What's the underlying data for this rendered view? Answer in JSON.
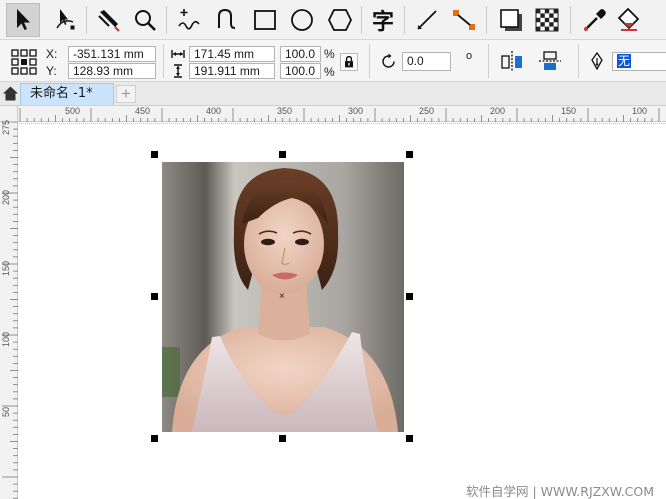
{
  "toolbox": {
    "tools": [
      {
        "name": "pick-tool",
        "icon": "arrow-pointer-icon",
        "active": true
      },
      {
        "name": "shape-tool",
        "icon": "node-shape-icon"
      },
      {
        "name": "smart-fill-tool",
        "icon": "knife-brush-icon"
      },
      {
        "name": "zoom-tool",
        "icon": "magnifier-icon"
      },
      {
        "name": "freehand-tool",
        "icon": "freehand-curve-icon"
      },
      {
        "name": "artistic-media-tool",
        "icon": "spiral-brush-icon"
      },
      {
        "name": "rectangle-tool",
        "icon": "rectangle-icon"
      },
      {
        "name": "ellipse-tool",
        "icon": "ellipse-icon"
      },
      {
        "name": "polygon-tool",
        "icon": "hexagon-icon"
      },
      {
        "name": "text-tool",
        "icon": "text-zi-icon",
        "glyph": "字"
      },
      {
        "name": "parallel-dimension-tool",
        "icon": "dimension-line-icon"
      },
      {
        "name": "connector-tool",
        "icon": "connector-icon"
      },
      {
        "name": "drop-shadow-tool",
        "icon": "drop-shadow-icon"
      },
      {
        "name": "transparency-tool",
        "icon": "checkerboard-icon"
      },
      {
        "name": "color-eyedropper-tool",
        "icon": "eyedropper-icon"
      },
      {
        "name": "interactive-fill-tool",
        "icon": "paint-bucket-icon"
      }
    ]
  },
  "propbar": {
    "x_label": "X:",
    "y_label": "Y:",
    "x_value": "-351.131 mm",
    "y_value": "128.93 mm",
    "width_value": "171.45 mm",
    "height_value": "191.911 mm",
    "scale_x": "100.0",
    "scale_y": "100.0",
    "percent": "%",
    "rotation": "0.0",
    "degree": "o",
    "outline_width": "无"
  },
  "tabs": {
    "document_title": "未命名 -1*",
    "add_label": "+"
  },
  "ruler": {
    "h_labels": [
      "500",
      "450",
      "400",
      "350",
      "300",
      "250",
      "200",
      "150",
      "100"
    ],
    "v_labels": [
      "275",
      "200",
      "150",
      "100",
      "50"
    ]
  },
  "watermark": "软件自学网 | WWW.RJZXW.COM"
}
